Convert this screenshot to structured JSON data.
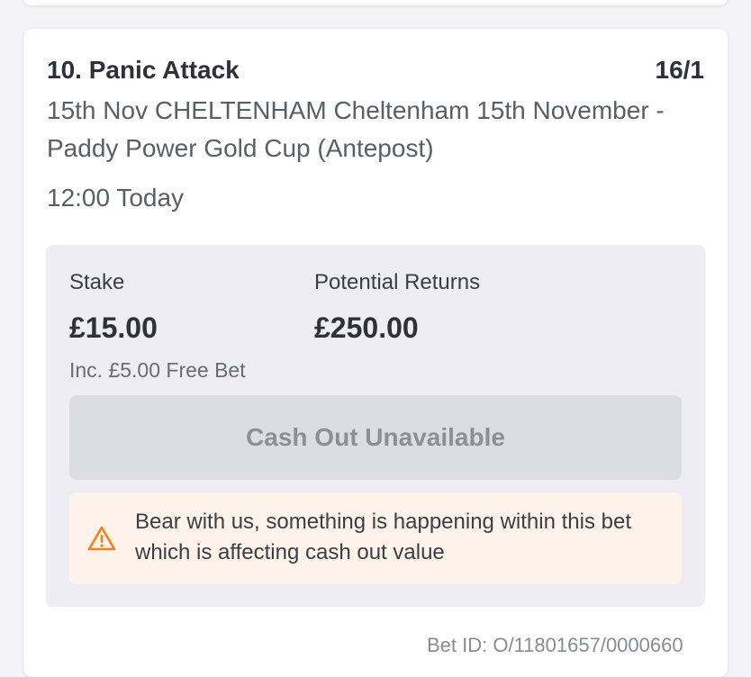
{
  "bet": {
    "selection": "10. Panic Attack",
    "odds": "16/1",
    "event": "15th Nov CHELTENHAM Cheltenham 15th November - Paddy Power Gold Cup (Antepost)",
    "time": "12:00 Today",
    "stake_label": "Stake",
    "stake_value": "£15.00",
    "returns_label": "Potential Returns",
    "returns_value": "£250.00",
    "free_bet_note": "Inc. £5.00 Free Bet",
    "cashout_label": "Cash Out Unavailable",
    "warning_text": "Bear with us, something is happening within this bet which is affecting cash out value",
    "bet_id": "Bet ID: O/11801657/0000660"
  },
  "icons": {
    "warning": "warning-triangle-icon"
  },
  "colors": {
    "warning_icon": "#f0821e",
    "warning_bg": "#fdf3ea",
    "panel_bg": "#ededf3",
    "button_bg": "#dcdde2",
    "button_text": "#8d8f96"
  }
}
